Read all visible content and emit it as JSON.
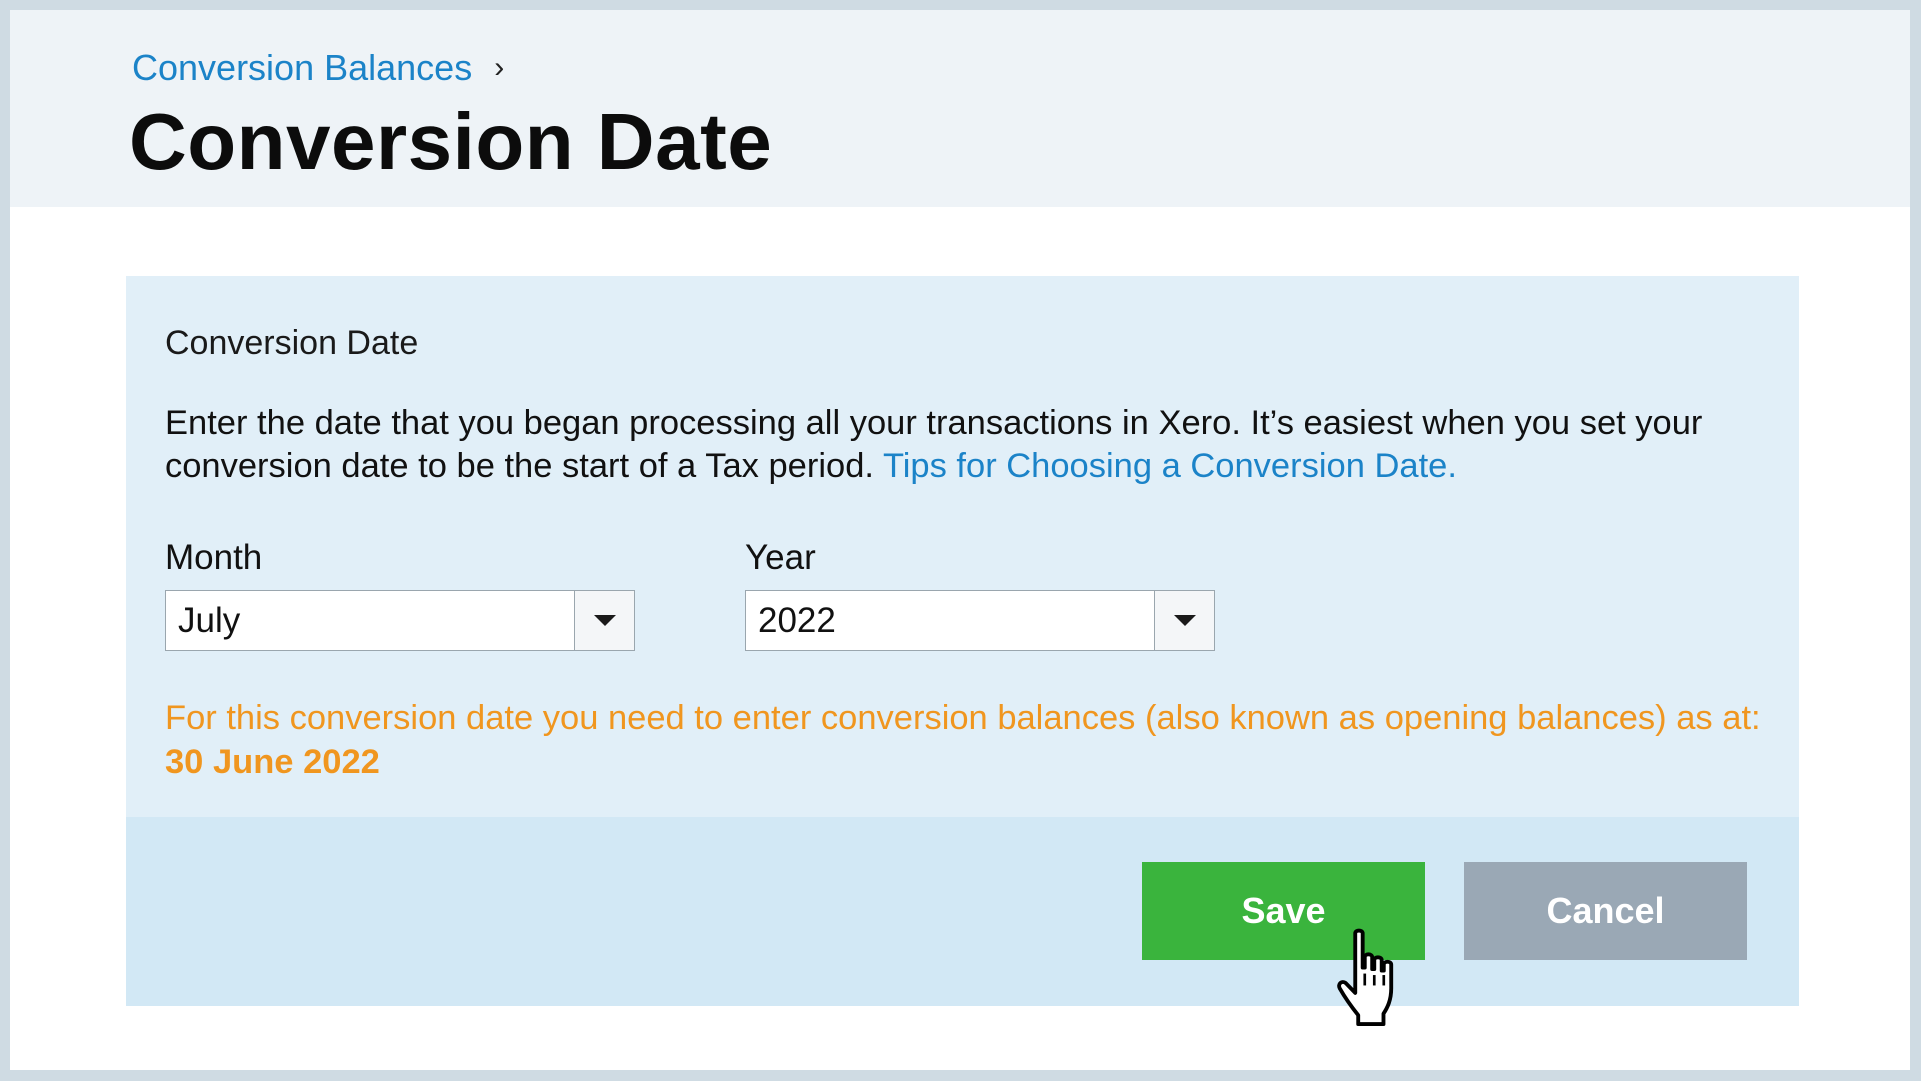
{
  "breadcrumb": {
    "parent_label": "Conversion Balances",
    "separator": "›"
  },
  "page": {
    "title": "Conversion Date"
  },
  "panel": {
    "heading": "Conversion Date",
    "instructions": "Enter the date that you began processing all your transactions in Xero. It’s easiest when you set your conversion date to be the start of a Tax period.",
    "tips_link": "Tips for Choosing a Conversion Date.",
    "month": {
      "label": "Month",
      "selected": "July"
    },
    "year": {
      "label": "Year",
      "selected": "2022"
    },
    "notice_text": "For this conversion date you need to enter conversion balances (also known as opening balances) as at: ",
    "notice_date": "30 June 2022"
  },
  "actions": {
    "save_label": "Save",
    "cancel_label": "Cancel"
  },
  "cursor": {
    "icon": "hand-pointer-icon"
  },
  "colors": {
    "link_blue": "#1b83c8",
    "save_green": "#3ab43d",
    "cancel_grey": "#9aa8b5",
    "notice_orange": "#f0961f",
    "panel_bg": "#e1eff8",
    "footer_bg": "#d2e8f5",
    "header_bg": "#eef3f7"
  }
}
